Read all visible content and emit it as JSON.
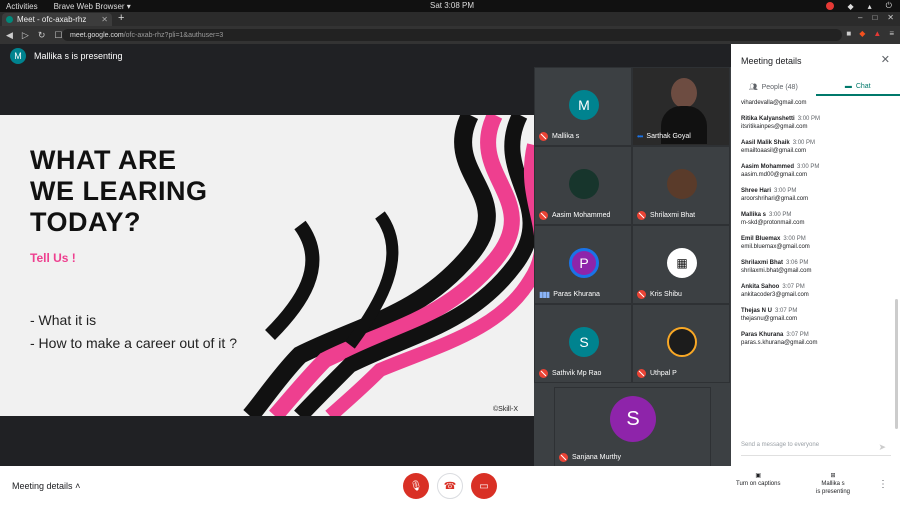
{
  "os": {
    "activities": "Activities",
    "browser_menu": "Brave Web Browser ▾",
    "clock": "Sat  3:08 PM"
  },
  "browser": {
    "tab_title": "Meet - ofc-axab-rhz",
    "url_host": "meet.google.com",
    "url_path": "/ofc-axab-rhz?pli=1&authuser=3"
  },
  "presenter": {
    "initial": "M",
    "text": "Mallika s is presenting"
  },
  "slide": {
    "title_lines": [
      "WHAT ARE",
      "WE LEARING",
      "TODAY?"
    ],
    "subtitle": "Tell Us !",
    "bullets": [
      "- What it is",
      "- How to make a career out of it ?"
    ],
    "credit": "©Skill-X",
    "accent_color": "#ee3f8f"
  },
  "participants": [
    {
      "name": "Mallika s",
      "initial": "M",
      "color": "#00838f",
      "muted": true
    },
    {
      "name": "Sarthak Goyal",
      "initial": "",
      "color": "#2a2a2a",
      "muted": false,
      "speaking": true
    },
    {
      "name": "Aasim Mohammed",
      "initial": "",
      "color": "#17352c",
      "muted": true
    },
    {
      "name": "Shrilaxmi Bhat",
      "initial": "",
      "color": "#5a3b2a",
      "muted": true
    },
    {
      "name": "Paras Khurana",
      "initial": "P",
      "color": "#8e24aa",
      "muted": false,
      "speaking": true
    },
    {
      "name": "Kris Shibu",
      "initial": "",
      "color": "#ffffff",
      "muted": true
    },
    {
      "name": "Sathvik Mp Rao",
      "initial": "S",
      "color": "#00838f",
      "muted": true
    },
    {
      "name": "Uthpal P",
      "initial": "",
      "color": "#1c1c1c",
      "muted": true
    },
    {
      "name": "Sanjana Murthy",
      "initial": "S",
      "color": "#8e24aa",
      "muted": true
    }
  ],
  "panel": {
    "title": "Meeting details",
    "tab_people": "People (48)",
    "tab_chat": "Chat",
    "messages": [
      {
        "sender": "",
        "time": "",
        "text": "vihardevalla@gmail.com"
      },
      {
        "sender": "Ritika Kalyanshetti",
        "time": "3:00 PM",
        "text": "itsritikainpes@gmail.com"
      },
      {
        "sender": "Aasil Malik Shaik",
        "time": "3:00 PM",
        "text": "emailtoaasil@gmail.com"
      },
      {
        "sender": "Aasim Mohammed",
        "time": "3:00 PM",
        "text": "aasim.md00@gmail.com"
      },
      {
        "sender": "Shree Hari",
        "time": "3:00 PM",
        "text": "aroorshrihari@gmail.com"
      },
      {
        "sender": "Mallika s",
        "time": "3:00 PM",
        "text": "m-skd@protonmail.com"
      },
      {
        "sender": "Emil Bluemax",
        "time": "3:00 PM",
        "text": "emil.bluemax@gmail.com"
      },
      {
        "sender": "Shrilaxmi Bhat",
        "time": "3:06 PM",
        "text": "shrilaxmi.bhat@gmail.com"
      },
      {
        "sender": "Ankita Sahoo",
        "time": "3:07 PM",
        "text": "ankitacoder3@gmail.com"
      },
      {
        "sender": "Thejas N U",
        "time": "3:07 PM",
        "text": "thejasnu@gmail.com"
      },
      {
        "sender": "Paras Khurana",
        "time": "3:07 PM",
        "text": "paras.s.khurana@gmail.com"
      }
    ],
    "compose_placeholder": "Send a message to everyone"
  },
  "bottom": {
    "meeting_details": "Meeting details",
    "captions": "Turn on captions",
    "presenting_line1": "Mallika s",
    "presenting_line2": "is presenting"
  }
}
